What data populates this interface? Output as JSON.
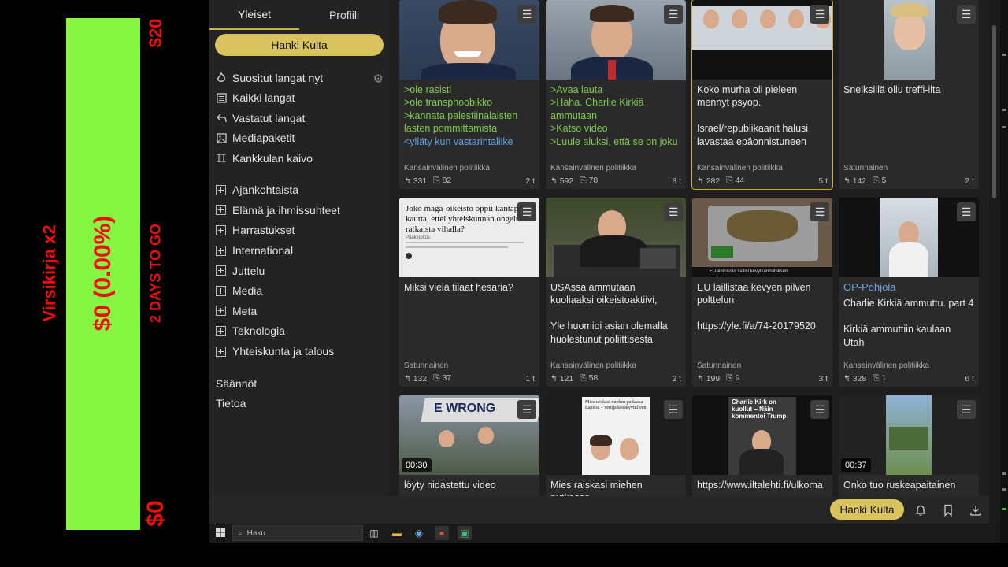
{
  "overlay": {
    "goal_name": "Virsikirja x2",
    "amount_text": "$0 (0.00%)",
    "deadline": "2 DAYS TO GO",
    "max_label": "$20",
    "min_label": "$0",
    "progress_fraction": 0.0,
    "colors": {
      "bar": "#85f542",
      "text": "#ee0e0e"
    }
  },
  "sidebar": {
    "tabs": [
      {
        "label": "Yleiset"
      },
      {
        "label": "Profiili"
      }
    ],
    "gold_button": "Hanki Kulta",
    "nav": [
      {
        "label": "Suositut langat nyt",
        "icon": "trending-icon"
      },
      {
        "label": "Kaikki langat",
        "icon": "list-icon"
      },
      {
        "label": "Vastatut langat",
        "icon": "reply-icon"
      },
      {
        "label": "Mediapaketit",
        "icon": "media-icon"
      },
      {
        "label": "Kankkulan kaivo",
        "icon": "grid-icon"
      }
    ],
    "categories": [
      "Ajankohtaista",
      "Elämä ja ihmissuhteet",
      "Harrastukset",
      "International",
      "Juttelu",
      "Media",
      "Meta",
      "Teknologia",
      "Yhteiskunta ja talous"
    ],
    "footer": [
      "Säännöt",
      "Tietoa"
    ]
  },
  "cards": [
    {
      "lines": [
        ">ole rasisti",
        ">ole transphoobikko",
        ">kannata palestiinalaisten lasten pommittamista"
      ],
      "blue_line": "<ylläty kun vastarintaliike",
      "category": "Kansainvälinen politiikka",
      "replies": "331",
      "images": "82",
      "age": "2 t"
    },
    {
      "lines": [
        ">Avaa lauta",
        ">Haha. Charlie Kirkiä ammutaan",
        ">Katso video",
        ">Luule aluksi, että se on joku"
      ],
      "category": "Kansainvälinen politiikka",
      "replies": "592",
      "images": "78",
      "age": "8 t"
    },
    {
      "text": "Koko murha oli pieleen mennyt psyop.\n\nIsrael/republikaanit halusi lavastaa epäonnistuneen",
      "category": "Kansainvälinen politiikka",
      "replies": "282",
      "images": "44",
      "age": "5 t"
    },
    {
      "text": "Sneiksillä ollu treffi-ilta",
      "category": "Satunnainen",
      "replies": "142",
      "images": "5",
      "age": "2 t"
    },
    {
      "text": "Miksi vielä tilaat hesaria?",
      "category": "Satunnainen",
      "replies": "132",
      "images": "37",
      "age": "1 t",
      "thumb_headline": "Joko maga-oikeisto oppii kantapään kautta, ettei yhteiskunnan ongelmia ratkaista vihalla?",
      "thumb_kicker": "Pääkirjoitus"
    },
    {
      "text": "USAssa ammutaan kuoliaaksi oikeistoaktiivi,\n\nYle huomioi asian olemalla huolestunut poliittisesta",
      "category": "Kansainvälinen politiikka",
      "replies": "121",
      "images": "58",
      "age": "2 t"
    },
    {
      "text": "EU laillistaa kevyen pilven polttelun\n\nhttps://yle.fi/a/74-20179520",
      "category": "Satunnainen",
      "replies": "199",
      "images": "9",
      "age": "3 t",
      "thumb_caption": "EU-komissio sallisi kevytkannabiksen"
    },
    {
      "title": "OP-Pohjola",
      "text": "Charlie Kirkiä ammuttu. part 4\n\nKirkiä ammuttiin kaulaan Utah",
      "category": "Kansainvälinen politiikka",
      "replies": "328",
      "images": "1",
      "age": "6 t"
    },
    {
      "text": "löyty hidastettu video",
      "duration": "00:30",
      "thumb_text": "E WRONG"
    },
    {
      "text": "Mies raiskasi miehen putkassa",
      "thumb_headline": "Mies raiskasi miehen putkassa Lapissa – vertija kesäkyyttilleen"
    },
    {
      "text": "https://www.iltalehti.fi/ulkoma",
      "thumb_headline": "Charlie Kirk on kuollut – Näin kommentoi Trump"
    },
    {
      "text": "Onko tuo ruskeapaitainen",
      "duration": "00:37"
    }
  ],
  "bottom_bar": {
    "gold_button": "Hanki Kulta"
  },
  "taskbar": {
    "search_placeholder": "Haku"
  }
}
